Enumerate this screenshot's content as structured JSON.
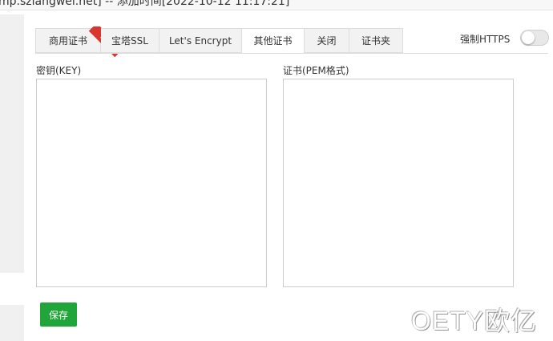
{
  "header": {
    "title": "mp.szlangwei.net] -- 添加时间[2022-10-12 11:17:21]"
  },
  "tabs": [
    {
      "label": "商用证书",
      "badge": "推荐"
    },
    {
      "label": "宝塔SSL"
    },
    {
      "label": "Let's Encrypt"
    },
    {
      "label": "其他证书",
      "active": true
    },
    {
      "label": "关闭"
    },
    {
      "label": "证书夹"
    }
  ],
  "force_https": {
    "label": "强制HTTPS",
    "enabled": false
  },
  "key": {
    "label": "密钥(KEY)",
    "value": ""
  },
  "certificate": {
    "label": "证书(PEM格式)",
    "value": ""
  },
  "actions": {
    "save_label": "保存"
  },
  "watermark": "OETY欧亿",
  "colors": {
    "save_button": "#20a53a",
    "badge": "#d9362f",
    "tab_background": "#f2f2f2"
  }
}
